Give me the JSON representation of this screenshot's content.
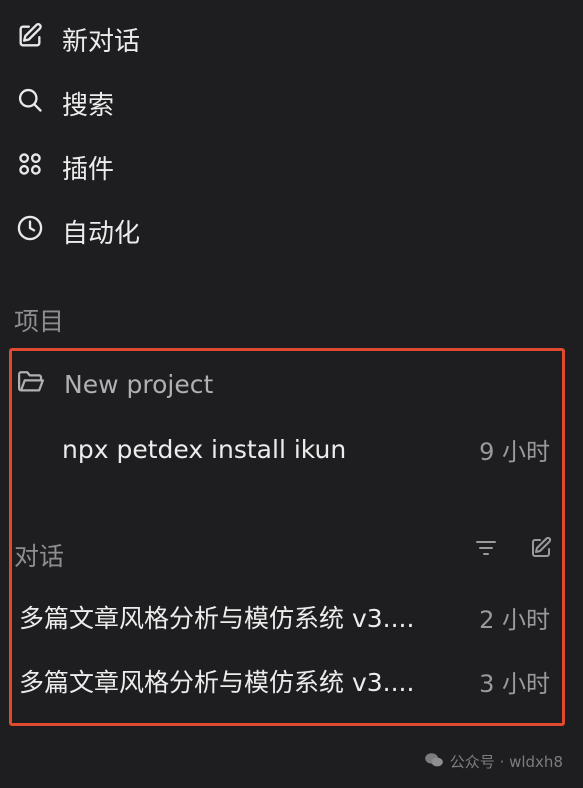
{
  "nav": {
    "new_chat": "新对话",
    "search": "搜索",
    "plugins": "插件",
    "automation": "自动化"
  },
  "projects": {
    "section_label": "项目",
    "project_name": "New project",
    "threads": [
      {
        "title": "npx petdex install ikun",
        "time": "9 小时"
      }
    ]
  },
  "conversations": {
    "section_label": "对话",
    "items": [
      {
        "title": "多篇文章风格分析与模仿系统 v3....",
        "time": "2 小时"
      },
      {
        "title": "多篇文章风格分析与模仿系统 v3....",
        "time": "3 小时"
      }
    ]
  },
  "watermark": "公众号 · wldxh8",
  "colors": {
    "background": "#1e1e20",
    "highlight_border": "#e04a2e",
    "muted_text": "#8e8e92"
  },
  "icons": [
    "edit-icon",
    "search-icon",
    "plugins-icon",
    "clock-icon",
    "folder-icon",
    "filter-icon",
    "new-chat-icon",
    "wechat-icon"
  ]
}
